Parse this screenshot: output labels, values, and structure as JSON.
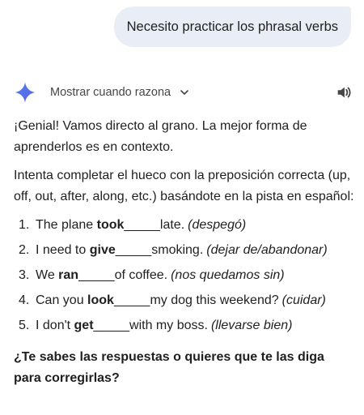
{
  "user_message": "Necesito practicar los phrasal verbs",
  "model_header": {
    "show_thinking_label": "Mostrar cuando razona"
  },
  "response": {
    "intro": "¡Genial! Vamos directo al grano. La mejor forma de aprenderlos es en contexto.",
    "instructions": "Intenta completar el hueco con la preposición correcta (up, off, out, after, along, etc.) basándote en la pista en español:",
    "exercises": [
      {
        "num": "1.",
        "before": "The plane ",
        "verb": "took",
        "blank": " _____ ",
        "after": "late.",
        "hint": "(despegó)"
      },
      {
        "num": "2.",
        "before": "I need to ",
        "verb": "give",
        "blank": " _____ ",
        "after": "smoking.",
        "hint": "(dejar de/abandonar)"
      },
      {
        "num": "3.",
        "before": "We ",
        "verb": "ran",
        "blank": " _____ ",
        "after": "of coffee.",
        "hint": "(nos quedamos sin)"
      },
      {
        "num": "4.",
        "before": "Can you ",
        "verb": "look",
        "blank": " _____ ",
        "after": "my dog this weekend?",
        "hint": "(cuidar)"
      },
      {
        "num": "5.",
        "before": "I don't ",
        "verb": "get",
        "blank": " _____ ",
        "after": "with my boss.",
        "hint": "(llevarse bien)"
      }
    ],
    "closing": "¿Te sabes las respuestas o quieres que te las diga para corregirlas?"
  },
  "colors": {
    "user_bubble": "#e9eef6",
    "text": "#1f1f1f",
    "muted": "#444746",
    "sparkle": "#4285f4"
  }
}
